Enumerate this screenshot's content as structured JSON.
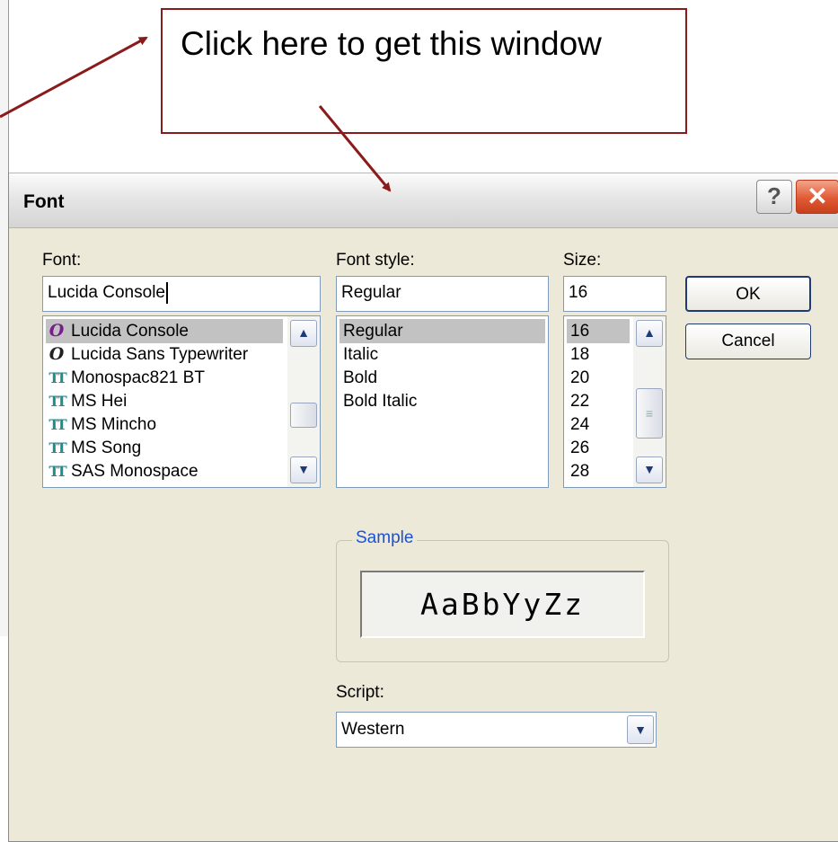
{
  "callout": {
    "text": "Click here to get this window"
  },
  "dialog": {
    "title": "Font",
    "help_glyph": "?",
    "close_glyph": "✕",
    "font_label": "Font:",
    "font_value": "Lucida Console",
    "fonts": [
      {
        "name": "Lucida Console",
        "icon": "opentype-icon",
        "glyph": "O",
        "selected": true
      },
      {
        "name": "Lucida Sans Typewriter",
        "icon": "opentype-icon",
        "glyph": "O",
        "selected": false
      },
      {
        "name": "Monospac821 BT",
        "icon": "truetype-icon",
        "glyph": "TT",
        "selected": false
      },
      {
        "name": "MS Hei",
        "icon": "truetype-icon",
        "glyph": "TT",
        "selected": false
      },
      {
        "name": "MS Mincho",
        "icon": "truetype-icon",
        "glyph": "TT",
        "selected": false
      },
      {
        "name": "MS Song",
        "icon": "truetype-icon",
        "glyph": "TT",
        "selected": false
      },
      {
        "name": "SAS Monospace",
        "icon": "truetype-icon",
        "glyph": "TT",
        "selected": false
      }
    ],
    "style_label": "Font style:",
    "style_value": "Regular",
    "styles": [
      "Regular",
      "Italic",
      "Bold",
      "Bold Italic"
    ],
    "size_label": "Size:",
    "size_value": "16",
    "sizes": [
      "16",
      "18",
      "20",
      "22",
      "24",
      "26",
      "28"
    ],
    "ok_label": "OK",
    "cancel_label": "Cancel",
    "sample_label": "Sample",
    "sample_text": "AaBbYyZz",
    "script_label": "Script:",
    "script_value": "Western"
  },
  "colors": {
    "arrow": "#8b1a1a",
    "title_bar": "#e6e6e6",
    "dialog_bg": "#ece9d8",
    "selection": "#c2c2c2"
  }
}
